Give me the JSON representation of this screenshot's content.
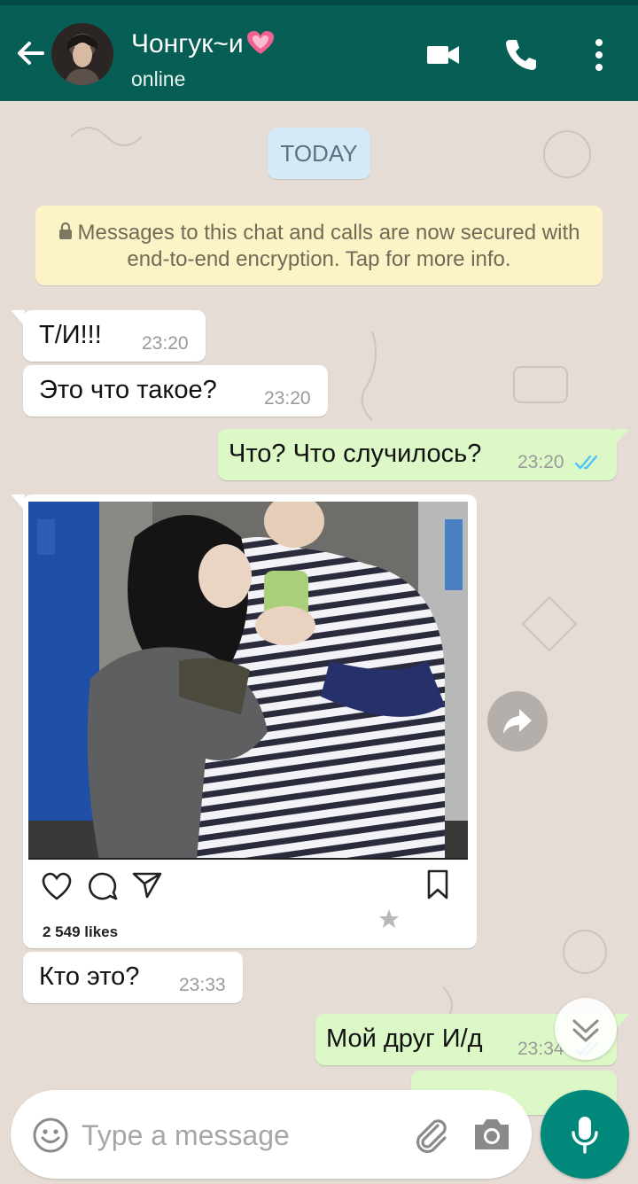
{
  "header": {
    "contact_name": "Чонгук~и",
    "status": "online"
  },
  "chat": {
    "date_label": "TODAY",
    "security_notice": "Messages to this chat and calls are now secured with end-to-end encryption. Tap for more info.",
    "messages": [
      {
        "direction": "in",
        "text": "Т/И!!!",
        "time": "23:20"
      },
      {
        "direction": "in",
        "text": "Это что такое?",
        "time": "23:20"
      },
      {
        "direction": "out",
        "text": "Что? Что случилось?",
        "time": "23:20",
        "read": true
      },
      {
        "direction": "in",
        "text": "Кто это?",
        "time": "23:33"
      },
      {
        "direction": "out",
        "text": "Мой друг И/д",
        "time": "23:34",
        "read": true
      }
    ],
    "shared_post": {
      "likes": "2 549 likes",
      "starred": true
    }
  },
  "composer": {
    "placeholder": "Type a message"
  },
  "colors": {
    "header": "#075e54",
    "outgoing_bubble": "#dcf8c6",
    "incoming_bubble": "#ffffff",
    "read_ticks": "#4fc3f7",
    "mic_button": "#00897b"
  },
  "icons": [
    "back-arrow-icon",
    "video-call-icon",
    "voice-call-icon",
    "more-options-icon",
    "lock-icon",
    "double-tick-icon",
    "heart-outline-icon",
    "comment-icon",
    "share-icon",
    "bookmark-icon",
    "star-icon",
    "forward-icon",
    "chevron-down-icon",
    "emoji-icon",
    "paperclip-icon",
    "camera-icon",
    "microphone-icon",
    "heart-emoji-icon"
  ]
}
